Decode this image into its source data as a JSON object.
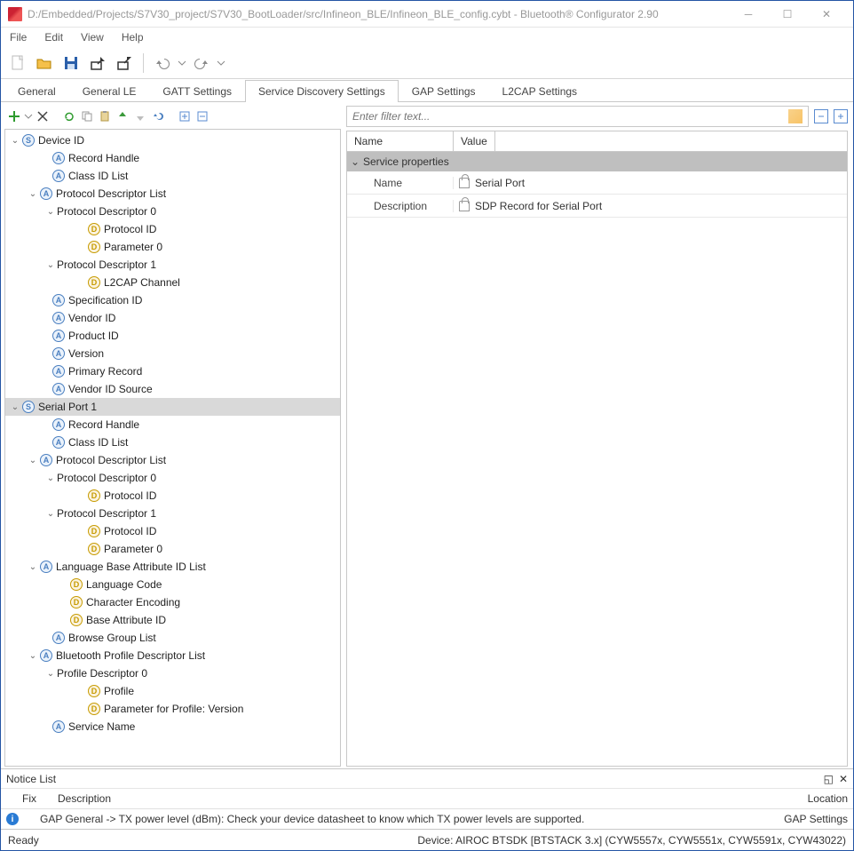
{
  "window": {
    "title": "D:/Embedded/Projects/S7V30_project/S7V30_BootLoader/src/Infineon_BLE/Infineon_BLE_config.cybt - Bluetooth® Configurator 2.90"
  },
  "menu": {
    "file": "File",
    "edit": "Edit",
    "view": "View",
    "help": "Help"
  },
  "tabs": {
    "general": "General",
    "generalle": "General LE",
    "gatt": "GATT Settings",
    "sds": "Service Discovery Settings",
    "gap": "GAP Settings",
    "l2cap": "L2CAP Settings"
  },
  "filter": {
    "placeholder": "Enter filter text..."
  },
  "propheader": {
    "name": "Name",
    "value": "Value"
  },
  "propcat": {
    "label": "Service properties"
  },
  "props": {
    "name": {
      "label": "Name",
      "value": "Serial Port"
    },
    "desc": {
      "label": "Description",
      "value": "SDP Record for Serial Port"
    }
  },
  "tree": {
    "n0": "Device ID",
    "n1": "Record Handle",
    "n2": "Class ID List",
    "n3": "Protocol Descriptor List",
    "n4": "Protocol Descriptor 0",
    "n5": "Protocol ID",
    "n6": "Parameter 0",
    "n7": "Protocol Descriptor 1",
    "n8": "L2CAP Channel",
    "n9": "Specification ID",
    "n10": "Vendor ID",
    "n11": "Product ID",
    "n12": "Version",
    "n13": "Primary Record",
    "n14": "Vendor ID Source",
    "n15": "Serial Port 1",
    "n16": "Record Handle",
    "n17": "Class ID List",
    "n18": "Protocol Descriptor List",
    "n19": "Protocol Descriptor 0",
    "n20": "Protocol ID",
    "n21": "Protocol Descriptor 1",
    "n22": "Protocol ID",
    "n23": "Parameter 0",
    "n24": "Language Base Attribute ID List",
    "n25": "Language Code",
    "n26": "Character Encoding",
    "n27": "Base Attribute ID",
    "n28": "Browse Group List",
    "n29": "Bluetooth Profile Descriptor List",
    "n30": "Profile Descriptor 0",
    "n31": "Profile",
    "n32": "Parameter for Profile: Version",
    "n33": "Service Name"
  },
  "notice": {
    "title": "Notice List",
    "fix": "Fix",
    "desc": "Description",
    "loc": "Location",
    "row": {
      "desc": "GAP General -> TX power level (dBm): Check your device datasheet to know which TX power levels are supported.",
      "loc": "GAP Settings"
    }
  },
  "status": {
    "ready": "Ready",
    "device": "Device: AIROC BTSDK [BTSTACK 3.x] (CYW5557x, CYW5551x, CYW5591x, CYW43022)"
  }
}
